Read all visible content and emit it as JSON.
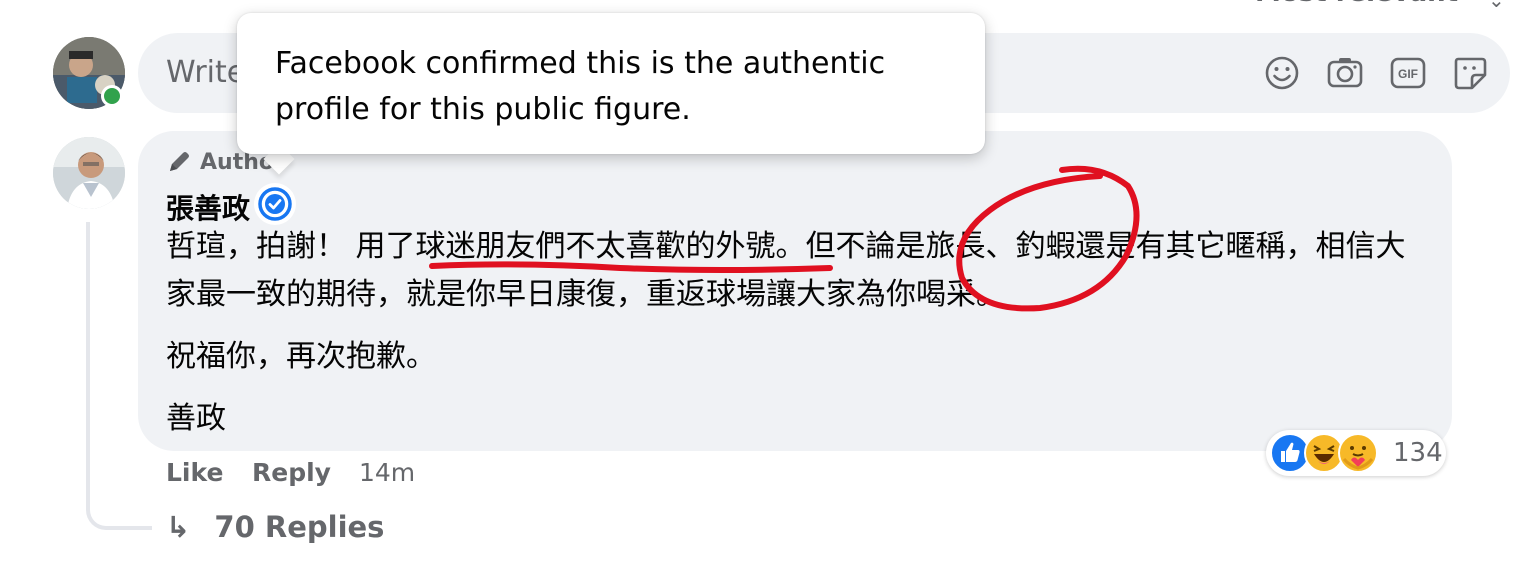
{
  "header": {
    "sort_label": "Most relevant"
  },
  "composer": {
    "placeholder": "Write"
  },
  "tooltip": {
    "text": "Facebook confirmed this is the authentic profile for this public figure."
  },
  "comment": {
    "badge": "Author",
    "author": "張善政",
    "paragraphs": [
      "哲瑄，拍謝！ 用了球迷朋友們不太喜歡的外號。但不論是旅長、釣蝦還是有其它暱稱，相信大家最一致的期待，就是你早日康復，重返球場讓大家為你喝采。",
      "祝福你，再次抱歉。",
      "善政"
    ],
    "actions": {
      "like": "Like",
      "reply": "Reply",
      "time": "14m"
    },
    "reactions": {
      "count": "134",
      "types": [
        "like",
        "haha",
        "care"
      ]
    },
    "replies": "70 Replies"
  },
  "colors": {
    "bubble": "#f0f2f5",
    "secondary_text": "#65676b",
    "verified_blue": "#1877f2",
    "online_green": "#31a24c",
    "annotation_red": "#e01020"
  },
  "icons": [
    "emoji-icon",
    "camera-icon",
    "gif-icon",
    "sticker-icon",
    "pencil-icon",
    "verified-icon",
    "reply-arrow-icon"
  ]
}
